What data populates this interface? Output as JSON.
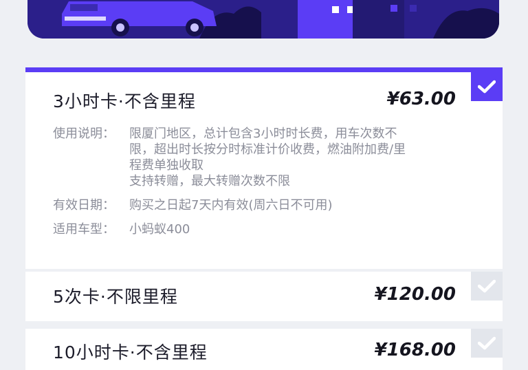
{
  "plans": [
    {
      "title": "3小时卡·不含里程",
      "price": "¥63.00",
      "selected": true,
      "usage_label": "使用说明：",
      "usage_lines": [
        "限厦门地区，总计包含3小时时长费，用车次数不",
        "限，超出时长按分时标准计价收费，燃油附加费/里",
        "程费单独收取",
        "支持转赠，最大转赠次数不限"
      ],
      "validity_label": "有效日期：",
      "validity": "购买之日起7天内有效(周六日不可用)",
      "model_label": "适用车型：",
      "model": "小蚂蚁400"
    },
    {
      "title": "5次卡·不限里程",
      "price": "¥120.00",
      "selected": false
    },
    {
      "title": "10小时卡·不含里程",
      "price": "¥168.00",
      "selected": false
    }
  ],
  "colors": {
    "accent": "#5b3df5",
    "banner": "#2b1f8a",
    "check_off": "#e3e6ec"
  },
  "icons": {
    "check": "checkmark-icon"
  }
}
